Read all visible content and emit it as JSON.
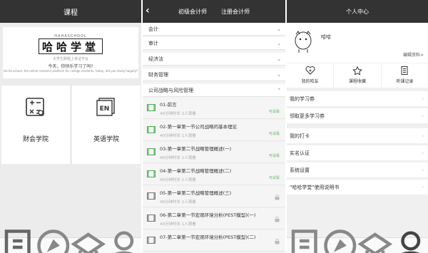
{
  "college": {
    "header_title": "课程",
    "logo_top": "HAHASCHOOL",
    "logo_main": "哈哈学堂",
    "logo_tagline": "大学生刷题上考证平台",
    "banner_question": "今天，你快乐学习了吗?",
    "banner_english": "Ha-ha school, the online research platform for college students, today, did you study happily?",
    "cards": [
      {
        "label": "财会学院",
        "icon": "calculator-icon"
      },
      {
        "label": "英语学院",
        "icon": "english-en-icon"
      }
    ],
    "tabbar": [
      "book-icon",
      "compass-icon",
      "cap-icon",
      "user-icon"
    ]
  },
  "course": {
    "back_icon": "chevron-left-icon",
    "tabs": [
      "初级会计师",
      "注册会计师"
    ],
    "sections": [
      "会计",
      "审计",
      "经济法",
      "财务管理",
      "公司战略与风险管理"
    ],
    "lessons": [
      {
        "title": "01-前言",
        "meta": "40分钟时长   1人观看",
        "status": "可试看"
      },
      {
        "title": "02-第一章第一节公司战略的基本理论",
        "meta": "40分钟时长   1人观看",
        "status": "可试看"
      },
      {
        "title": "03-第一章第二节战略管理概述(一)",
        "meta": "40分钟时长   1人观看",
        "status": "可试看"
      },
      {
        "title": "04-第一章第二节战略管理概述(二)",
        "meta": "40分钟时长   1人观看",
        "status": "可试看"
      },
      {
        "title": "05-第一章第二节战略管理概述(三)",
        "meta": "40分钟时长   1人观看",
        "status": ""
      },
      {
        "title": "06-第二章第一节宏观环境分析(PEST模型)(一)",
        "meta": "40分钟时长   1人观看",
        "status": ""
      },
      {
        "title": "07-第二章第一节宏观环境分析(PEST模型)(二)",
        "meta": "",
        "status": ""
      }
    ]
  },
  "profile": {
    "header_title": "个人中心",
    "username": "哈哈",
    "edit_label": "编辑资料>",
    "actions": [
      {
        "label": "我的哈友",
        "icon": "heart-plus-icon"
      },
      {
        "label": "课程收藏",
        "icon": "star-icon"
      },
      {
        "label": "听课记录",
        "icon": "record-icon"
      }
    ],
    "menu": [
      "我的学习券",
      "领取更多学习券",
      "我的打卡",
      "实名认证",
      "系统设置",
      "\"哈哈学堂\"使用说明书"
    ]
  },
  "colors": {
    "header": "#333333",
    "status_green": "#5cb85c",
    "video_green": "#4caf50"
  }
}
